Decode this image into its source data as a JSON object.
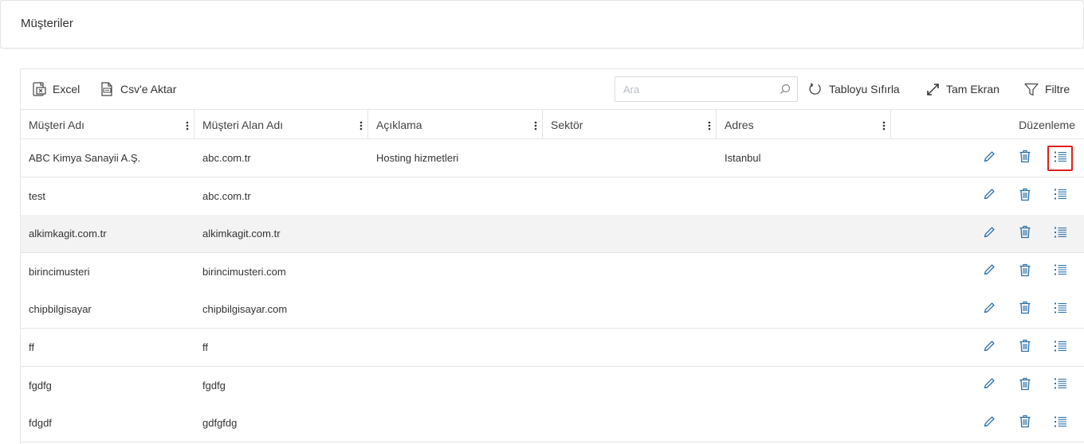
{
  "page": {
    "title": "Müşteriler"
  },
  "toolbar": {
    "excel": {
      "label": "Excel",
      "icon": "excel-icon"
    },
    "csv": {
      "label": "Csv'e Aktar",
      "icon": "csv-file-icon"
    },
    "search": {
      "placeholder": "Ara",
      "value": ""
    },
    "reset": {
      "label": "Tabloyu Sıfırla",
      "icon": "refresh-icon"
    },
    "fullscreen": {
      "label": "Tam Ekran",
      "icon": "expand-icon"
    },
    "filter": {
      "label": "Filtre",
      "icon": "filter-icon"
    }
  },
  "table": {
    "columns": [
      "Müşteri Adı",
      "Müşteri Alan Adı",
      "Açıklama",
      "Sektör",
      "Adres"
    ],
    "actions_header": "Düzenleme",
    "rows": [
      {
        "name": "ABC Kimya Sanayii A.Ş.",
        "domain": "abc.com.tr",
        "description": "Hosting hizmetleri",
        "sector": "",
        "address": "Istanbul"
      },
      {
        "name": "test",
        "domain": "abc.com.tr",
        "description": "",
        "sector": "",
        "address": ""
      },
      {
        "name": "alkimkagit.com.tr",
        "domain": "alkimkagit.com.tr",
        "description": "",
        "sector": "",
        "address": ""
      },
      {
        "name": "birincimusteri",
        "domain": "birincimusteri.com",
        "description": "",
        "sector": "",
        "address": ""
      },
      {
        "name": "chipbilgisayar",
        "domain": "chipbilgisayar.com",
        "description": "",
        "sector": "",
        "address": ""
      },
      {
        "name": "ff",
        "domain": "ff",
        "description": "",
        "sector": "",
        "address": ""
      },
      {
        "name": "fgdfg",
        "domain": "fgdfg",
        "description": "",
        "sector": "",
        "address": ""
      },
      {
        "name": "fdgdf",
        "domain": "gdfgfdg",
        "description": "",
        "sector": "",
        "address": ""
      }
    ],
    "row_actions": [
      "pencil-icon",
      "trash-icon",
      "list-icon"
    ]
  },
  "colors": {
    "icon_blue": "#2a6fa8",
    "highlight": "#e01e1e",
    "border": "#e3e5e8"
  }
}
